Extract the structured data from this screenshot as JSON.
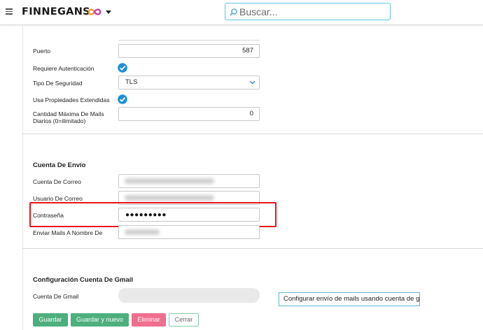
{
  "header": {
    "brand": "FINNEGANS",
    "search_placeholder": "Buscar..."
  },
  "smtp": {
    "port_label": "Puerto",
    "port_value": "587",
    "auth_label": "Requiere Autenticación",
    "auth_checked": true,
    "security_label": "Tipo De Seguridad",
    "security_value": "TLS",
    "extended_label": "Usa Propiedades Extendidas",
    "extended_checked": true,
    "max_mails_label_1": "Cantidad Máxima De Mails",
    "max_mails_label_2": "Diarios (0=ilimitado)",
    "max_mails_value": "0"
  },
  "sender": {
    "section_title": "Cuenta De Envío",
    "account_label": "Cuenta De Correo",
    "user_label": "Usuario De Correo",
    "password_label": "Contraseña",
    "password_value": "●●●●●●●●●",
    "sender_name_label": "Enviar Mails A Nombre De"
  },
  "gmail": {
    "section_title": "Configuración Cuenta De Gmail",
    "account_label": "Cuenta De Gmail",
    "configure_button": "Configurar envío de mails usando cuenta de gmail"
  },
  "actions": {
    "save": "Guardar",
    "save_new": "Guardar y nuevo",
    "delete": "Eliminar",
    "close": "Cerrar"
  },
  "colors": {
    "accent": "#4caf7d",
    "danger": "#f06e8e",
    "check": "#1c8fd8",
    "highlight": "#e8131f"
  }
}
